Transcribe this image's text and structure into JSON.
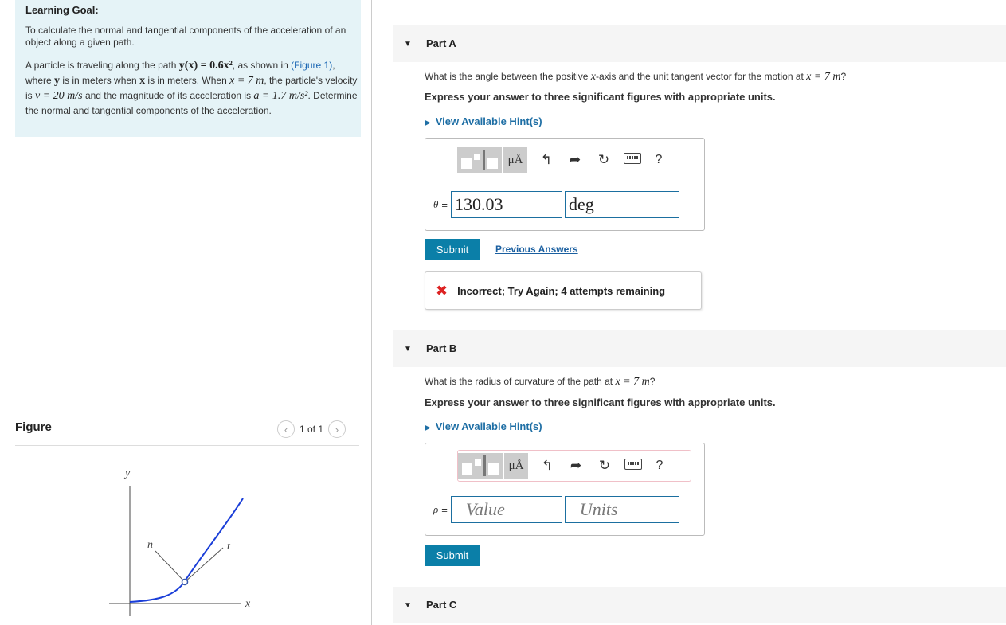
{
  "learning_goal": {
    "title": "Learning Goal:",
    "paragraph1": "To calculate the normal and tangential components of the acceleration of an object along a given path.",
    "p2_pre": "A particle is traveling along the path ",
    "p2_eq": "y(x) = 0.6x²",
    "p2_mid1": ", as shown in ",
    "p2_figure_link": "(Figure 1)",
    "p2_mid2": ", where ",
    "p2_y": "y",
    "p2_mid3": " is in meters when ",
    "p2_x": "x",
    "p2_mid4": " is in meters. When ",
    "p2_xval": "x = 7 m",
    "p2_mid5": ", the particle's velocity is ",
    "p2_v": "v = 20 m/s",
    "p2_mid6": " and the magnitude of its acceleration is ",
    "p2_a": "a = 1.7 m/s²",
    "p2_end": ". Determine the normal and tangential components of the acceleration."
  },
  "figure": {
    "title": "Figure",
    "pager": "1 of 1",
    "axis_y": "y",
    "axis_x": "x",
    "label_n": "n",
    "label_t": "t"
  },
  "part_a": {
    "label": "Part A",
    "question_pre": "What is the angle between the positive ",
    "question_x": "x",
    "question_mid": "-axis and the unit tangent vector for the motion at ",
    "question_xval": "x = 7 m",
    "question_end": "?",
    "express": "Express your answer to three significant figures with appropriate units.",
    "hint": "View Available Hint(s)",
    "symbol": "θ",
    "equals": "=",
    "value": "130.03",
    "units": "deg",
    "submit": "Submit",
    "previous_answers": "Previous Answers",
    "feedback": "Incorrect; Try Again; 4 attempts remaining"
  },
  "part_b": {
    "label": "Part B",
    "question_pre": "What is the radius of curvature of the path at ",
    "question_xval": "x = 7 m",
    "question_end": "?",
    "express": "Express your answer to three significant figures with appropriate units.",
    "hint": "View Available Hint(s)",
    "symbol": "ρ",
    "equals": "=",
    "value_placeholder": "Value",
    "units_placeholder": "Units",
    "submit": "Submit"
  },
  "part_c": {
    "label": "Part C"
  },
  "toolbar": {
    "units_button": "μÅ",
    "undo_icon": "undo-icon",
    "redo_icon": "redo-icon",
    "reset_icon": "reset-icon",
    "keyboard_icon": "keyboard-icon",
    "help": "?"
  },
  "colors": {
    "accent": "#0b7fa8",
    "goal_bg": "#e5f3f7",
    "curve": "#1a3ed8",
    "error": "#dd2222"
  }
}
